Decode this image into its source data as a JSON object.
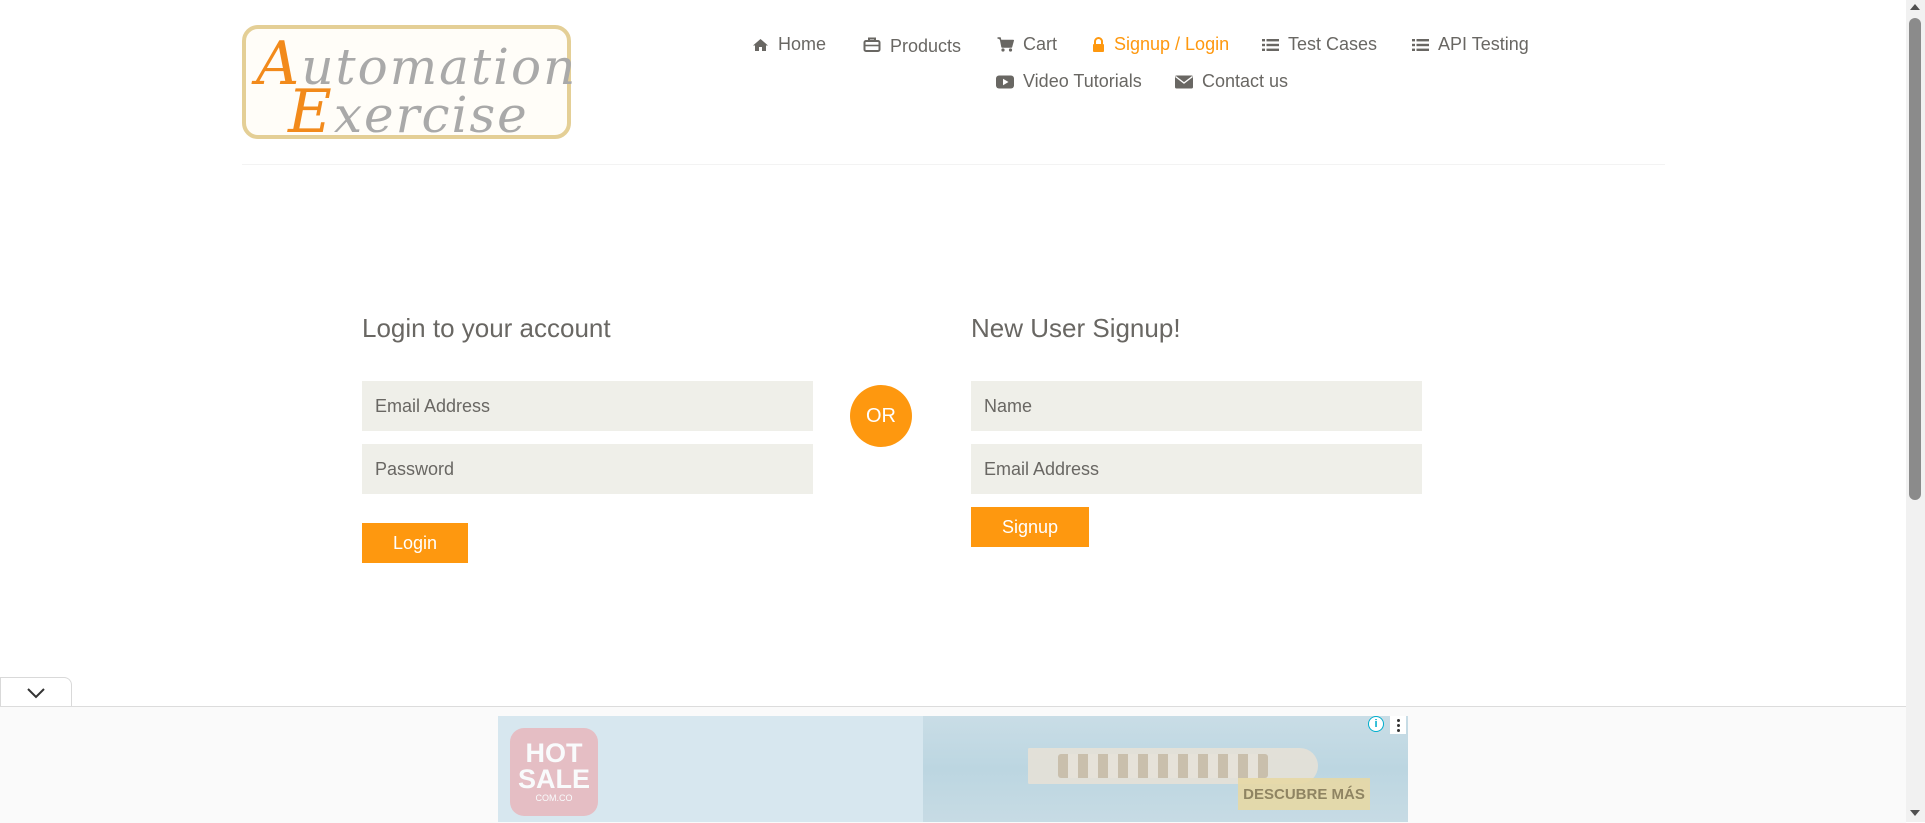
{
  "header": {
    "logo_line1": {
      "cap": "A",
      "rest": "utomation"
    },
    "logo_line2": {
      "cap": "E",
      "rest": "xercise"
    },
    "nav": [
      {
        "label": "Home",
        "icon": "home-icon"
      },
      {
        "label": "Products",
        "icon": "briefcase-icon"
      },
      {
        "label": "Cart",
        "icon": "cart-icon"
      },
      {
        "label": "Signup / Login",
        "icon": "lock-icon",
        "active": true
      },
      {
        "label": "Test Cases",
        "icon": "list-icon"
      },
      {
        "label": "API Testing",
        "icon": "list-icon"
      },
      {
        "label": "Video Tutorials",
        "icon": "youtube-icon"
      },
      {
        "label": "Contact us",
        "icon": "envelope-icon"
      }
    ]
  },
  "login": {
    "title": "Login to your account",
    "email_placeholder": "Email Address",
    "password_placeholder": "Password",
    "button": "Login"
  },
  "or_label": "OR",
  "signup": {
    "title": "New User Signup!",
    "name_placeholder": "Name",
    "email_placeholder": "Email Address",
    "button": "Signup"
  },
  "ad": {
    "brand": "HOT SALE",
    "brand_sub": "COM.CO",
    "cta": "DESCUBRE MÁS",
    "info_icon": "info-icon",
    "menu_icon": "more-vertical-icon"
  },
  "colors": {
    "accent": "#fe980f",
    "text": "#696763",
    "field_bg": "#efefe9"
  }
}
